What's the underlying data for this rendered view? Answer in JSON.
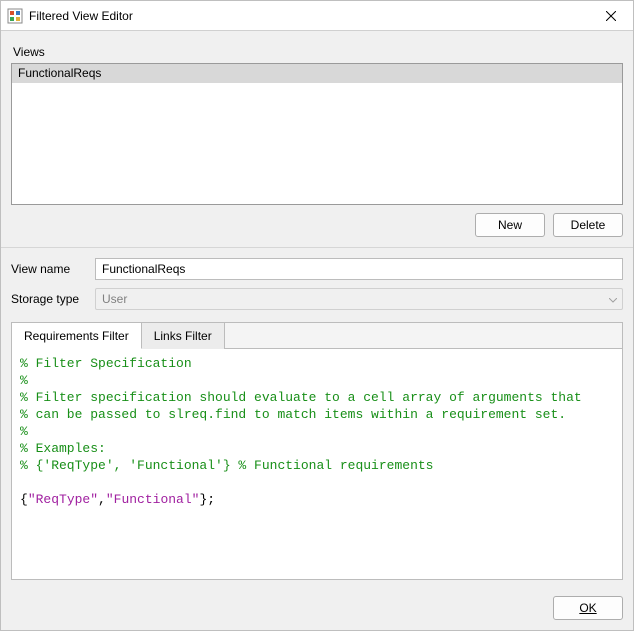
{
  "window": {
    "title": "Filtered View Editor"
  },
  "views": {
    "label": "Views",
    "items": [
      "FunctionalReqs"
    ],
    "selectedIndex": 0
  },
  "buttons": {
    "new": "New",
    "delete": "Delete",
    "ok": "OK"
  },
  "form": {
    "viewNameLabel": "View name",
    "viewNameValue": "FunctionalReqs",
    "storageTypeLabel": "Storage type",
    "storageTypeValue": "User",
    "storageTypeDisabled": true
  },
  "tabs": {
    "items": [
      "Requirements Filter",
      "Links Filter"
    ],
    "activeIndex": 0
  },
  "code": {
    "lines": [
      {
        "type": "comment",
        "text": "% Filter Specification"
      },
      {
        "type": "comment",
        "text": "%"
      },
      {
        "type": "comment",
        "text": "% Filter specification should evaluate to a cell array of arguments that"
      },
      {
        "type": "comment",
        "text": "% can be passed to slreq.find to match items within a requirement set."
      },
      {
        "type": "comment",
        "text": "%"
      },
      {
        "type": "comment",
        "text": "% Examples:"
      },
      {
        "type": "comment",
        "text": "% {'ReqType', 'Functional'} % Functional requirements"
      },
      {
        "type": "blank",
        "text": ""
      },
      {
        "type": "code",
        "tokens": [
          {
            "cls": "br",
            "text": "{"
          },
          {
            "cls": "st",
            "text": "\"ReqType\""
          },
          {
            "cls": "br",
            "text": ","
          },
          {
            "cls": "st",
            "text": "\"Functional\""
          },
          {
            "cls": "br",
            "text": "};"
          }
        ]
      }
    ]
  }
}
